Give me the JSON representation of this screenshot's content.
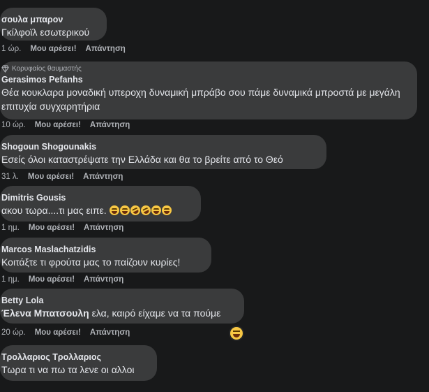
{
  "comments": [
    {
      "author": "σουλα μπαρον",
      "text": "Γκίλφοϊλ εσωτερικού",
      "time": "1 ώρ.",
      "like": "Μου αρέσει!",
      "reply": "Απάντηση"
    },
    {
      "badge": "Κορυφαίος θαυμαστής",
      "author": "Gerasimos Pefanhs",
      "text": "Θέα κουκλαρα μοναδική υπεροχη δυναμική μπράβο σου πάμε δυναμικά μπροστά με μεγάλη επιτυχία συγχαρητήρια",
      "time": "10 ώρ.",
      "like": "Μου αρέσει!",
      "reply": "Απάντηση"
    },
    {
      "author": "Shogoun Shogounakis",
      "text": "Εσείς όλοι καταστρέψατε την Ελλάδα και θα το βρείτε από το Θεό",
      "time": "31 λ.",
      "like": "Μου αρέσει!",
      "reply": "Απάντηση"
    },
    {
      "author": "Dimitris Gousis",
      "text": "ακου τωρα....τι μας ειπε.",
      "emojis": 6,
      "time": "1 ημ.",
      "like": "Μου αρέσει!",
      "reply": "Απάντηση"
    },
    {
      "author": "Marcos Maslachatzidis",
      "text": "Κοιτάξτε τι φρούτα μας το παίζουν κυρίες!",
      "time": "1 ημ.",
      "like": "Μου αρέσει!",
      "reply": "Απάντηση"
    },
    {
      "author": "Betty Lola",
      "mention": "Έλενα Μπατσουλη",
      "text": "ελα, καιρό είχαμε να τα πούμε",
      "time": "20 ώρ.",
      "like": "Μου αρέσει!",
      "reply": "Απάντηση",
      "reaction": "laughing-emoji"
    },
    {
      "author": "Τρολλαριος Τρολλαριος",
      "text": "Τωρα τι να πω τα λενε οι αλλοι"
    }
  ],
  "colors": {
    "background": "#18191a",
    "bubble": "#3a3b3c",
    "text": "#e4e6eb",
    "secondary": "#b0b3b8"
  }
}
